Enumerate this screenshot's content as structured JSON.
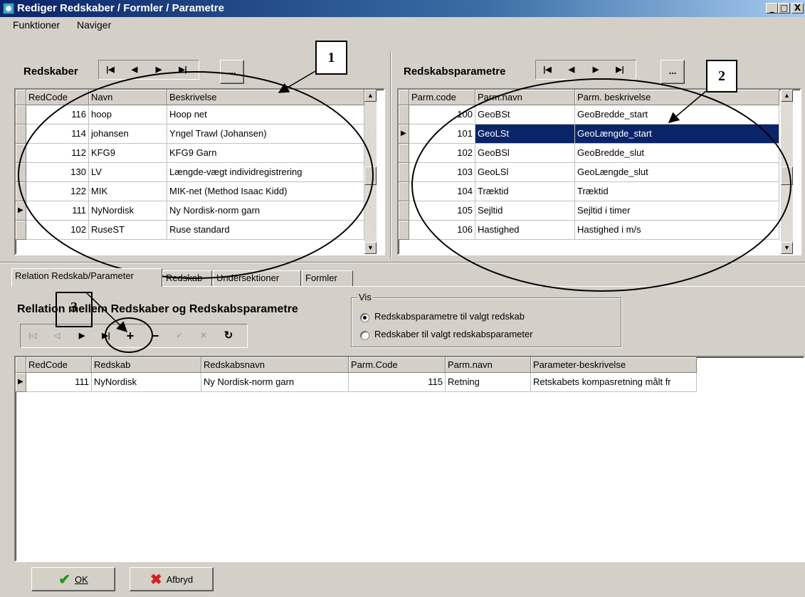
{
  "window": {
    "title": "Rediger Redskaber / Formler / Parametre",
    "controls": {
      "minimize": "_",
      "maximize": "□",
      "close": "X"
    }
  },
  "menu": [
    {
      "label": "Funktioner"
    },
    {
      "label": "Naviger"
    }
  ],
  "redskaber": {
    "title": "Redskaber",
    "nav": [
      "|◀",
      "◀",
      "▶",
      "▶|"
    ],
    "more_button": "...",
    "columns": [
      "RedCode",
      "Navn",
      "Beskrivelse"
    ],
    "rows": [
      [
        "116",
        "hoop",
        "Hoop net"
      ],
      [
        "114",
        "johansen",
        "Yngel Trawl (Johansen)"
      ],
      [
        "112",
        "KFG9",
        "KFG9 Garn"
      ],
      [
        "130",
        "LV",
        "Længde-vægt individregistrering"
      ],
      [
        "122",
        "MIK",
        "MIK-net (Method Isaac Kidd)"
      ],
      [
        "111",
        "NyNordisk",
        "Ny Nordisk-norm garn"
      ],
      [
        "102",
        "RuseST",
        "Ruse standard"
      ]
    ],
    "current_row_index": 5
  },
  "redskabsparametre": {
    "title": "Redskabsparametre",
    "nav": [
      "|◀",
      "◀",
      "▶",
      "▶|"
    ],
    "more_button": "...",
    "columns": [
      "Parm.code",
      "Parm.navn",
      "Parm. beskrivelse"
    ],
    "rows": [
      [
        "100",
        "GeoBSt",
        "GeoBredde_start"
      ],
      [
        "101",
        "GeoLSt",
        "GeoLængde_start"
      ],
      [
        "102",
        "GeoBSl",
        "GeoBredde_slut"
      ],
      [
        "103",
        "GeoLSl",
        "GeoLængde_slut"
      ],
      [
        "104",
        "Træktid",
        "Træktid"
      ],
      [
        "105",
        "Sejltid",
        "Sejltid i timer"
      ],
      [
        "106",
        "Hastighed",
        "Hastighed i m/s"
      ]
    ],
    "selected_row_index": 1
  },
  "tabs": [
    {
      "label": "Relation Redskab/Parameter",
      "active": true
    },
    {
      "label": "Redskab"
    },
    {
      "label": "Undersektioner"
    },
    {
      "label": "Formler"
    }
  ],
  "relation": {
    "heading": "Rellation mellem Redskaber og Redskabsparametre",
    "nav": [
      "|◁",
      "◁",
      "▶",
      "▶|",
      "+",
      "−",
      "✓",
      "✕",
      "↻"
    ],
    "vis": {
      "legend": "Vis",
      "options": [
        {
          "label": "Redskabsparametre til valgt redskab",
          "checked": true
        },
        {
          "label": "Redskaber til valgt redskabsparameter",
          "checked": false
        }
      ]
    },
    "columns": [
      "RedCode",
      "Redskab",
      "Redskabsnavn",
      "Parm.Code",
      "Parm.navn",
      "Parameter-beskrivelse"
    ],
    "rows": [
      [
        "111",
        "NyNordisk",
        "Ny Nordisk-norm garn",
        "115",
        "Retning",
        "Retskabets kompasretning målt fr"
      ]
    ]
  },
  "buttons": {
    "ok": "OK",
    "cancel": "Afbryd"
  },
  "annotations": {
    "callout1": "1",
    "callout2": "2",
    "callout3": "3"
  },
  "colors": {
    "selection": "#0a246a",
    "face": "#d4d0c8",
    "ok_check": "#1a9a1a",
    "cancel_x": "#d42020"
  }
}
